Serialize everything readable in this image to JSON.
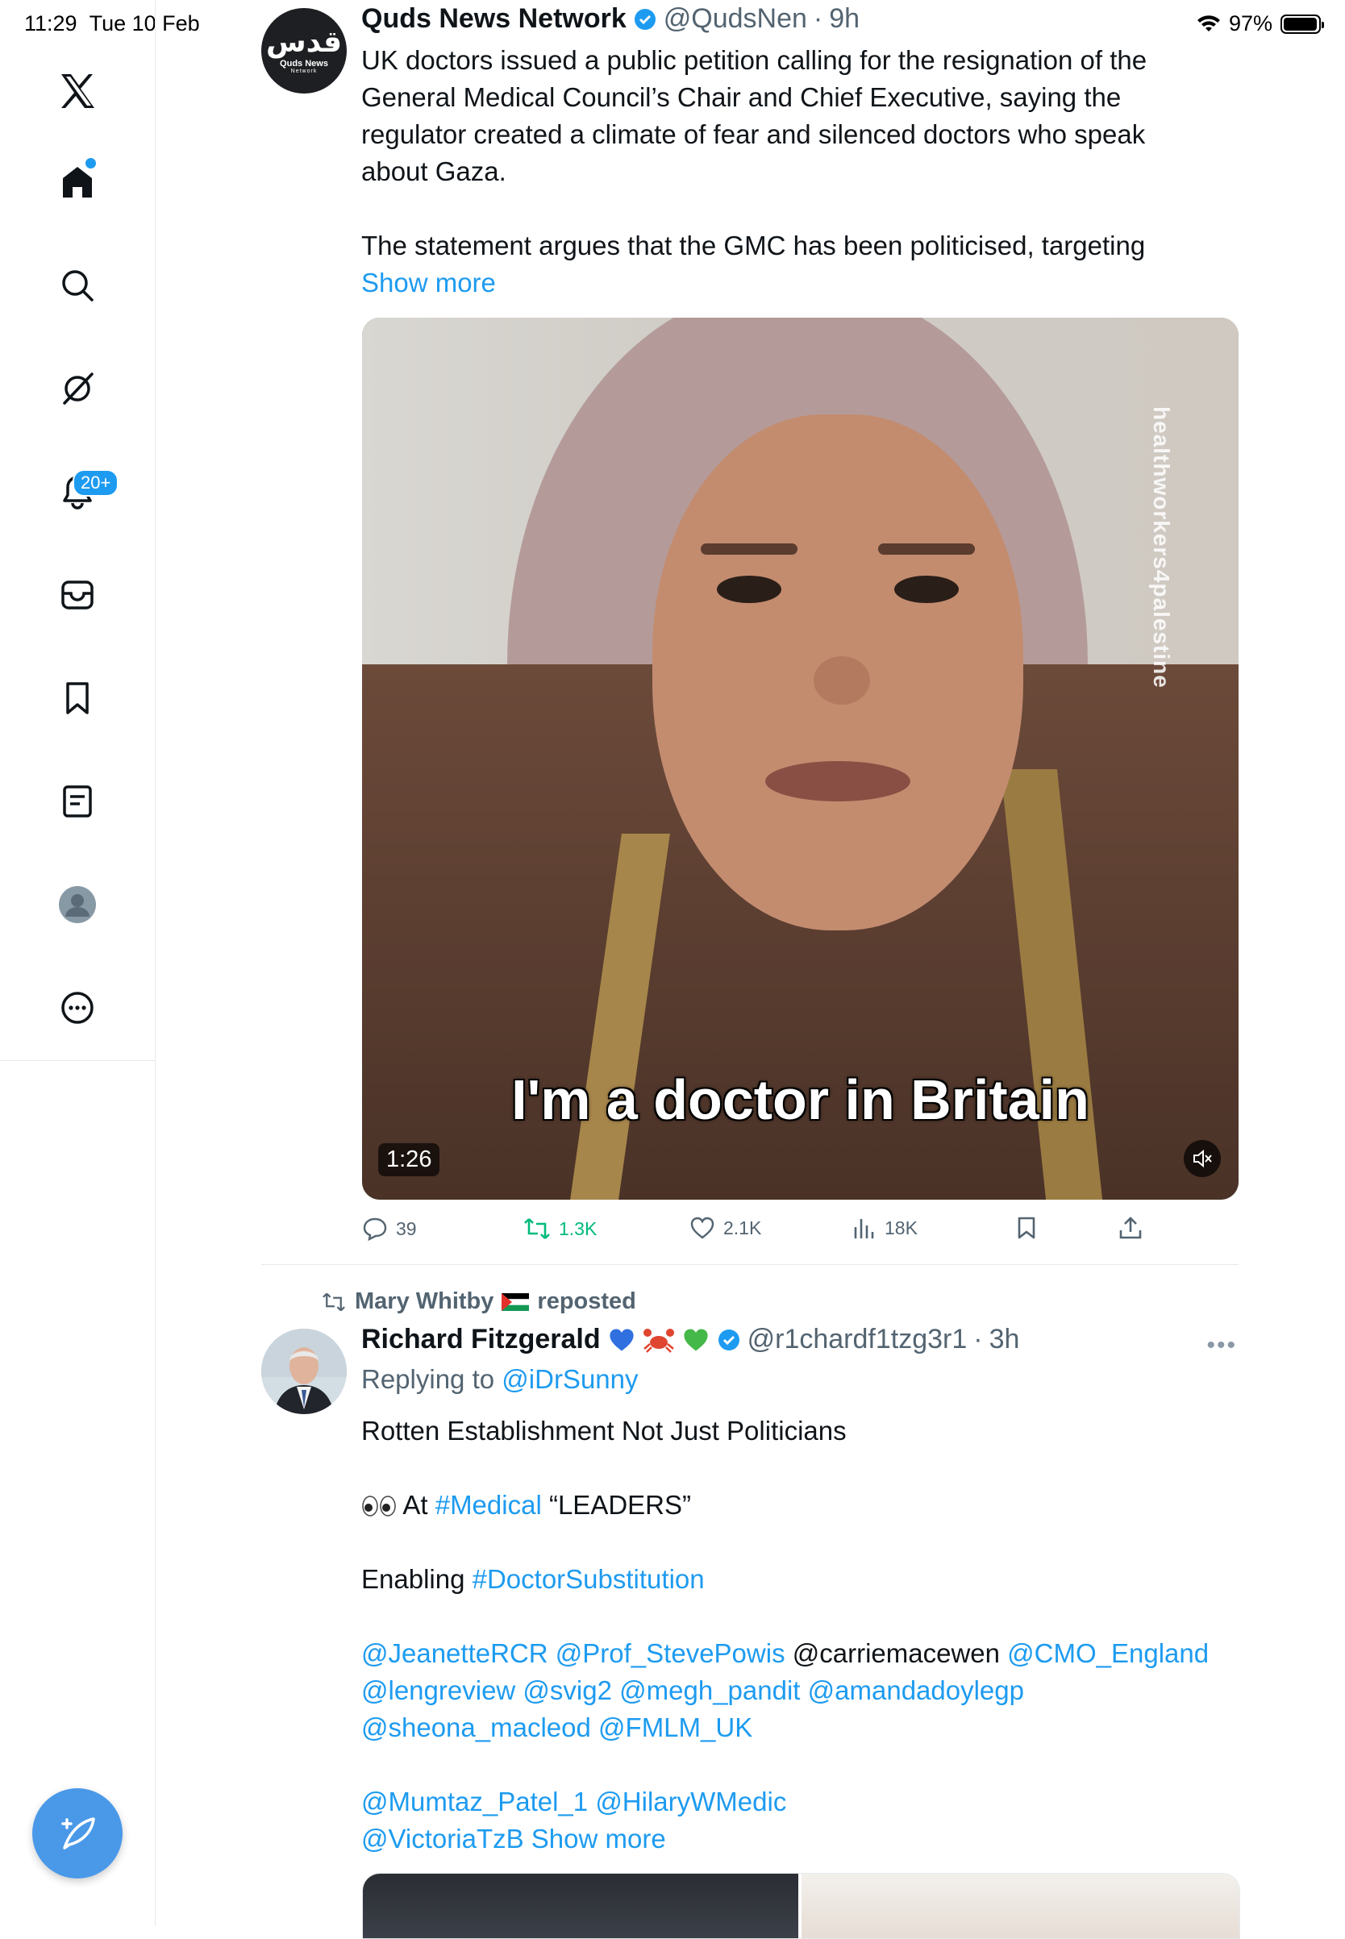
{
  "status_bar": {
    "time": "11:29",
    "date": "Tue 10 Feb",
    "battery": "97%"
  },
  "sidebar": {
    "notifications_badge": "20+",
    "items": [
      "x-logo-icon",
      "home-icon",
      "search-icon",
      "grok-icon",
      "notifications-icon",
      "messages-icon",
      "bookmarks-icon",
      "lists-icon",
      "profile-icon",
      "more-icon"
    ]
  },
  "tweet1": {
    "avatar_text_ar": "قدس",
    "avatar_text_en": "Quds News",
    "avatar_text_en2": "Network",
    "name": "Quds News Network",
    "handle": "@QudsNen",
    "time": "9h",
    "text_p1": "UK doctors issued a public petition calling for the resignation of the General Medical Council’s Chair and Chief Executive, saying the regulator created a climate of fear and silenced doctors who speak about Gaza.",
    "text_p2": "The statement argues that the GMC has been politicised, targeting",
    "show_more": "Show more",
    "video": {
      "watermark": "healthworkers4palestine",
      "caption": "I'm a doctor in Britain",
      "duration": "1:26"
    },
    "actions": {
      "replies": "39",
      "reposts": "1.3K",
      "likes": "2.1K",
      "views": "18K"
    }
  },
  "tweet2": {
    "reposted_by": "Mary Whitby",
    "reposted_label": "reposted",
    "name": "Richard Fitzgerald",
    "handle": "@r1chardf1tzg3r1",
    "time": "3h",
    "replying_label": "Replying to",
    "replying_to": "@iDrSunny",
    "line1": "Rotten Establishment Not Just Politicians",
    "line2_prefix": "At",
    "line2_tag": "#Medical",
    "line2_suffix": "“LEADERS”",
    "line3_prefix": "Enabling",
    "line3_tag": "#DoctorSubstitution",
    "mentions_a": [
      "@JeanetteRCR",
      "@Prof_StevePowis"
    ],
    "mention_plain": "@carriemacewen",
    "mentions_b": [
      "@CMO_England",
      "@lengreview",
      "@svig2",
      "@megh_pandit",
      "@amandadoylegp",
      "@sheona_macleod",
      "@FMLM_UK"
    ],
    "mentions_c": [
      "@Mumtaz_Patel_1",
      "@HilaryWMedic",
      "@VictoriaTzB"
    ],
    "show_more": "Show more"
  },
  "colors": {
    "accent": "#1d9bf0",
    "repost_green": "#00ba7c",
    "muted": "#536471"
  }
}
